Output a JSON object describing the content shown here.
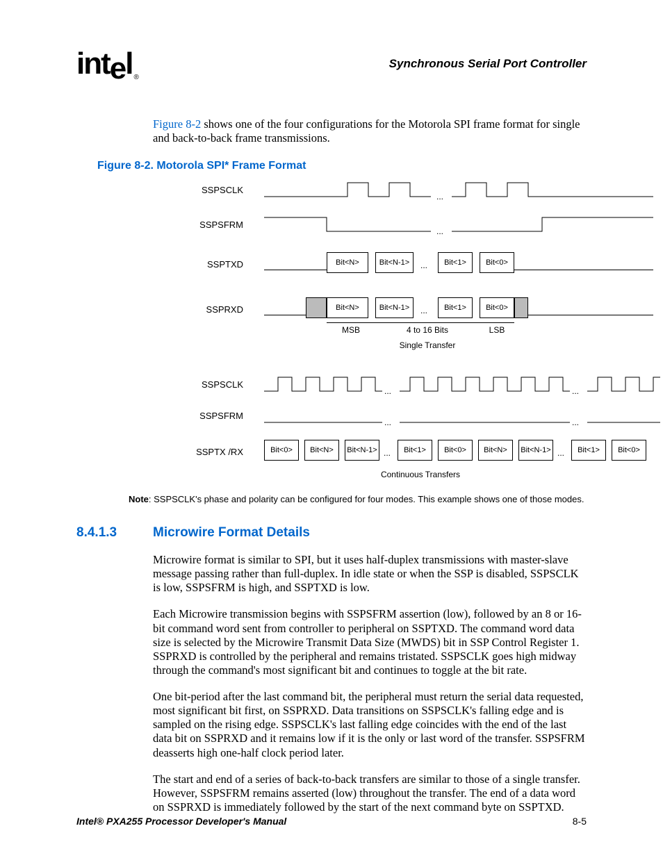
{
  "header": {
    "logo_text": "intel",
    "doc_section": "Synchronous Serial Port Controller"
  },
  "intro": {
    "link": "Figure 8-2",
    "rest": " shows one of the four configurations for the Motorola SPI frame format for single and back-to-back frame transmissions."
  },
  "figure": {
    "title": "Figure 8-2. Motorola SPI* Frame Format",
    "signals_single": [
      "SSPSCLK",
      "SSPSFRM",
      "SSPTXD",
      "SSPRXD"
    ],
    "signals_cont": [
      "SSPSCLK",
      "SSPSFRM",
      "SSPTX /RX"
    ],
    "bits_tx": [
      "Bit<N>",
      "Bit<N-1>",
      "Bit<1>",
      "Bit<0>"
    ],
    "bits_rx": [
      "Bit<N>",
      "Bit<N-1>",
      "Bit<1>",
      "Bit<0>"
    ],
    "msb": "MSB",
    "range": "4 to 16 Bits",
    "lsb": "LSB",
    "single_caption": "Single Transfer",
    "cont_bits": [
      "Bit<0>",
      "Bit<N>",
      "Bit<N-1>",
      "Bit<1>",
      "Bit<0>",
      "Bit<N>",
      "Bit<N-1>",
      "Bit<1>",
      "Bit<0>"
    ],
    "cont_caption": "Continuous Transfers",
    "dots": "..."
  },
  "note": {
    "label": "Note",
    "text": ": SSPSCLK's phase and polarity can be configured for four modes. This example shows one of those modes."
  },
  "section": {
    "number": "8.4.1.3",
    "title": "Microwire Format Details"
  },
  "paragraphs": [
    "Microwire format is similar to SPI, but it uses half-duplex transmissions with master-slave message passing rather than full-duplex. In idle state or when the SSP is disabled, SSPSCLK is low, SSPSFRM is high, and SSPTXD is low.",
    "Each Microwire transmission begins with SSPSFRM assertion (low), followed by an 8 or 16-bit command word sent from controller to peripheral on SSPTXD. The command word data size is selected by the Microwire Transmit Data Size (MWDS) bit in SSP Control Register 1. SSPRXD is controlled by the peripheral and remains tristated. SSPSCLK goes high midway through the command's most significant bit and continues to toggle at the bit rate.",
    "One bit-period after the last command bit, the peripheral must return the serial data requested, most significant bit first, on SSPRXD. Data transitions on SSPSCLK's falling edge and is sampled on the rising edge. SSPSCLK's last falling edge coincides with the end of the last data bit on SSPRXD and it remains low if it is the only or last word of the transfer. SSPSFRM deasserts high one-half clock period later.",
    "The start and end of a series of back-to-back transfers are similar to those of a single transfer. However, SSPSFRM remains asserted (low) throughout the transfer. The end of a data word on SSPRXD is immediately followed by the start of the next command byte on SSPTXD."
  ],
  "footer": {
    "manual": "Intel® PXA255 Processor Developer's Manual",
    "page": "8-5"
  }
}
